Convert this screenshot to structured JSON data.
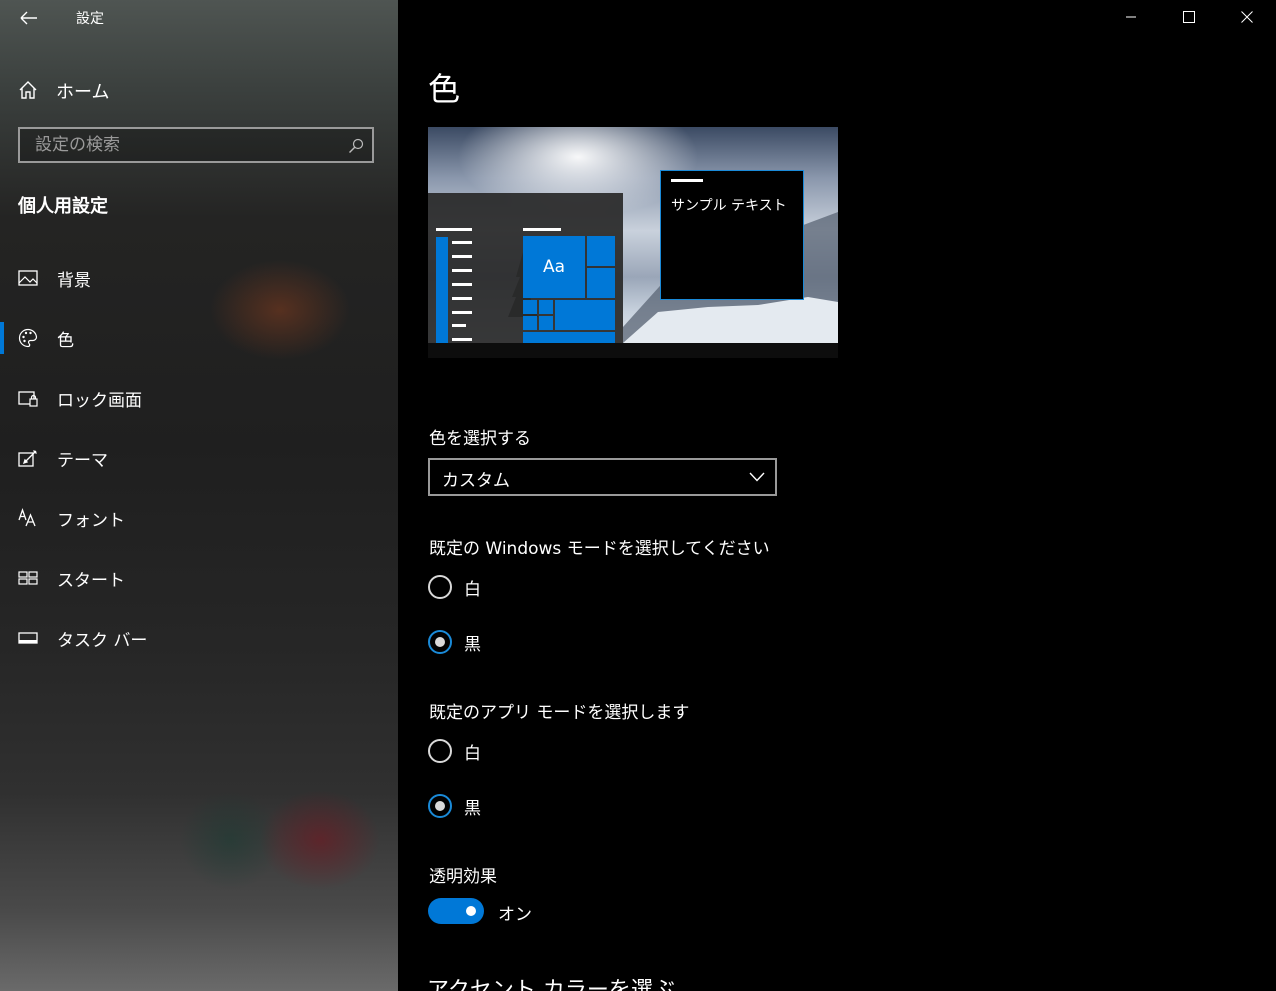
{
  "app": {
    "title": "設定"
  },
  "sidebar": {
    "home_label": "ホーム",
    "search_placeholder": "設定の検索",
    "section_title": "個人用設定",
    "items": [
      {
        "label": "背景",
        "icon": "picture-icon"
      },
      {
        "label": "色",
        "icon": "palette-icon",
        "selected": true
      },
      {
        "label": "ロック画面",
        "icon": "lock-screen-icon"
      },
      {
        "label": "テーマ",
        "icon": "theme-edit-icon"
      },
      {
        "label": "フォント",
        "icon": "font-icon"
      },
      {
        "label": "スタート",
        "icon": "start-icon"
      },
      {
        "label": "タスク バー",
        "icon": "taskbar-icon"
      }
    ]
  },
  "main": {
    "title": "色",
    "preview": {
      "tile_text": "Aa",
      "sample_text": "サンプル テキスト"
    },
    "choose_color": {
      "label": "色を選択する",
      "value": "カスタム"
    },
    "windows_mode": {
      "label": "既定の Windows モードを選択してください",
      "options": [
        {
          "label": "白",
          "checked": false
        },
        {
          "label": "黒",
          "checked": true
        }
      ]
    },
    "app_mode": {
      "label": "既定のアプリ モードを選択します",
      "options": [
        {
          "label": "白",
          "checked": false
        },
        {
          "label": "黒",
          "checked": true
        }
      ]
    },
    "transparency": {
      "label": "透明効果",
      "state_label": "オン",
      "on": true
    },
    "accent_heading": "アクセント カラーを選ぶ"
  },
  "colors": {
    "accent": "#0078d7",
    "background": "#000000"
  }
}
